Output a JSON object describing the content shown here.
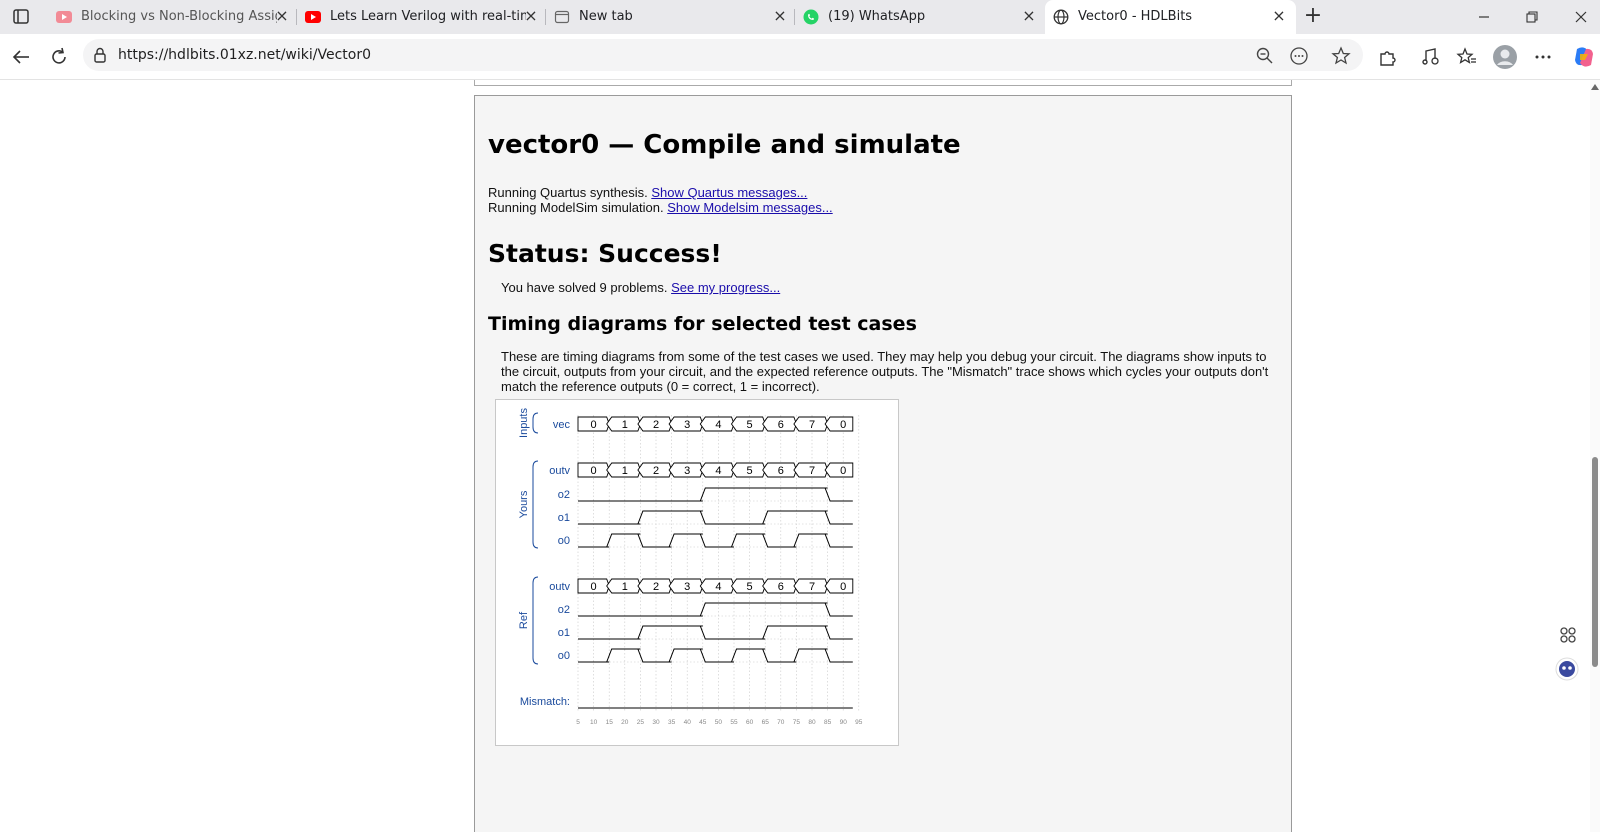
{
  "browser": {
    "tabs": [
      {
        "title": "Blocking vs Non-Blocking Assignm",
        "icon": "youtube-icon"
      },
      {
        "title": "Lets Learn Verilog with real-time P",
        "icon": "youtube-icon"
      },
      {
        "title": "New tab",
        "icon": "new-tab-icon"
      },
      {
        "title": "(19) WhatsApp",
        "icon": "whatsapp-icon"
      },
      {
        "title": "Vector0 - HDLBits",
        "icon": "globe-icon"
      }
    ],
    "url": "https://hdlbits.01xz.net/wiki/Vector0"
  },
  "result": {
    "title": "vector0 — Compile and simulate",
    "quartus_text": "Running Quartus synthesis.",
    "quartus_link": "Show Quartus messages...",
    "modelsim_text": "Running ModelSim simulation.",
    "modelsim_link": "Show Modelsim messages...",
    "status": "Status: Success!",
    "solved_text": "You have solved 9 problems.",
    "progress_link": "See my progress...",
    "timing_heading": "Timing diagrams for selected test cases",
    "timing_desc": "These are timing diagrams from some of the test cases we used. They may help you debug your circuit. The diagrams show inputs to the circuit, outputs from your circuit, and the expected reference outputs. The \"Mismatch\" trace shows which cycles your outputs don't match the reference outputs (0 = correct, 1 = incorrect)."
  },
  "timing": {
    "groups": {
      "inputs": "Inputs",
      "yours": "Yours",
      "ref": "Ref"
    },
    "signal_labels": {
      "vec": "vec",
      "outv": "outv",
      "o2": "o2",
      "o1": "o1",
      "o0": "o0",
      "mismatch": "Mismatch:"
    },
    "bus_values": [
      "0",
      "1",
      "2",
      "3",
      "4",
      "5",
      "6",
      "7",
      "0"
    ],
    "o2": [
      0,
      0,
      0,
      0,
      1,
      1,
      1,
      1,
      0
    ],
    "o1": [
      0,
      0,
      1,
      1,
      0,
      0,
      1,
      1,
      0
    ],
    "o0": [
      0,
      1,
      0,
      1,
      0,
      1,
      0,
      1,
      0
    ],
    "mismatch": [
      0,
      0,
      0,
      0,
      0,
      0,
      0,
      0,
      0
    ],
    "time_ticks": [
      "5",
      "10",
      "15",
      "20",
      "25",
      "30",
      "35",
      "40",
      "45",
      "50",
      "55",
      "60",
      "65",
      "70",
      "75",
      "80",
      "85",
      "90",
      "95"
    ],
    "colors": {
      "label": "#1a4a9c",
      "wave": "#000000",
      "grid": "#c8c8c8"
    }
  }
}
